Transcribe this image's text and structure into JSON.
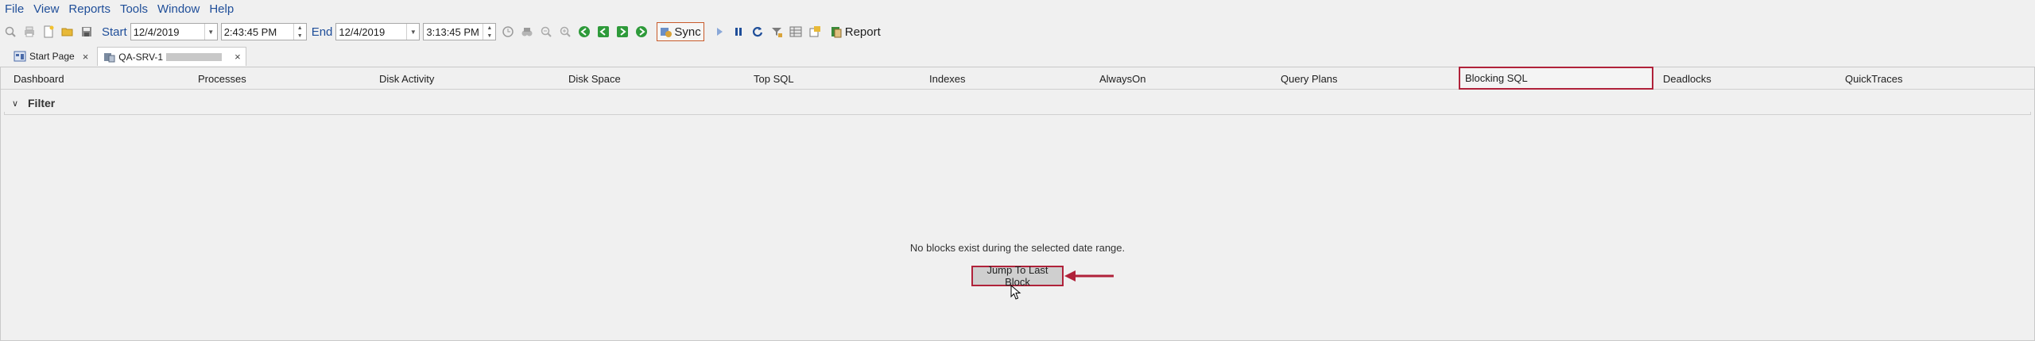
{
  "menu": [
    "File",
    "View",
    "Reports",
    "Tools",
    "Window",
    "Help"
  ],
  "toolbar": {
    "start_label": "Start",
    "start_date": "12/4/2019",
    "start_time": "2:43:45 PM",
    "end_label": "End",
    "end_date": "12/4/2019",
    "end_time": "3:13:45 PM",
    "sync_label": "Sync",
    "report_label": "Report"
  },
  "doc_tabs": [
    {
      "label": "Start Page",
      "close": "×"
    },
    {
      "label": "QA-SRV-1",
      "close": "×"
    }
  ],
  "view_tabs": [
    "Dashboard",
    "Processes",
    "Disk Activity",
    "Disk Space",
    "Top SQL",
    "Indexes",
    "AlwaysOn",
    "Query Plans",
    "Blocking SQL",
    "Deadlocks",
    "QuickTraces"
  ],
  "selected_view_tab": "Blocking SQL",
  "filter": {
    "label": "Filter",
    "chevron": "∨"
  },
  "content": {
    "message": "No blocks exist during the selected date range.",
    "button_label": "Jump To Last Block"
  },
  "colors": {
    "accent": "#1f4e99",
    "highlight": "#b0223a",
    "sync_border": "#c85a2a"
  }
}
